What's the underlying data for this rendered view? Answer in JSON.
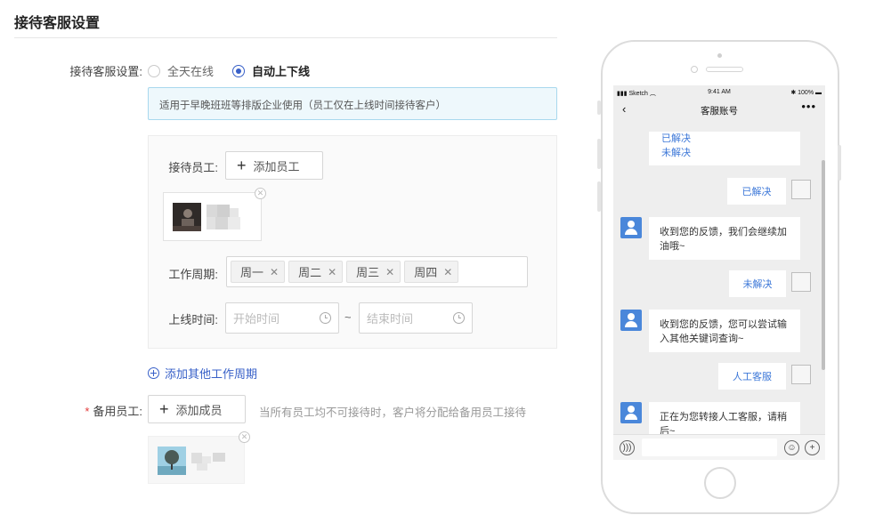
{
  "page": {
    "title": "接待客服设置"
  },
  "reception": {
    "label": "接待客服设置:",
    "options": [
      "全天在线",
      "自动上下线"
    ],
    "selected_index": 1,
    "notice": "适用于早晚班班等排版企业使用（员工仅在上线时间接待客户）"
  },
  "staff": {
    "label": "接待员工:",
    "add_button": "添加员工"
  },
  "work_cycle": {
    "label": "工作周期:",
    "days": [
      "周一",
      "周二",
      "周三",
      "周四"
    ]
  },
  "online_time": {
    "label": "上线时间:",
    "start_placeholder": "开始时间",
    "separator": "~",
    "end_placeholder": "结束时间"
  },
  "add_cycle_link": "添加其他工作周期",
  "backup": {
    "required_mark": "*",
    "label": "备用员工:",
    "add_button": "添加成员",
    "hint": "当所有员工均不可接待时，客户将分配给备用员工接待"
  },
  "phone": {
    "status_left": "Sketch",
    "status_time": "9:41 AM",
    "status_right": "100%",
    "nav_back": "‹",
    "nav_title": "客服账号",
    "nav_more": "•••",
    "messages": {
      "top_links": [
        "已解决",
        "未解决"
      ],
      "m1": "已解决",
      "r1": "收到您的反馈，我们会继续加油哦~",
      "m2": "未解决",
      "r2": "收到您的反馈，您可以尝试输入其他关键词查询~",
      "m3": "人工客服",
      "r3": "正在为您转接人工客服，请稍后~"
    }
  },
  "colors": {
    "accent": "#3860c8",
    "notice_bg": "#eef8fc",
    "chat_blue": "#4a87da"
  }
}
